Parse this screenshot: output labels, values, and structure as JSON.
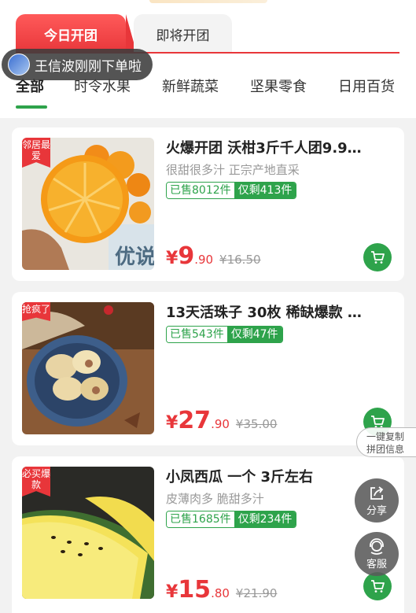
{
  "tabs": {
    "today": "今日开团",
    "upcoming": "即将开团"
  },
  "toast": {
    "text": "王信波刚刚下单啦"
  },
  "categories": [
    "全部",
    "时令水果",
    "新鲜蔬菜",
    "坚果零食",
    "日用百货"
  ],
  "products": [
    {
      "badge": "邻居最爱",
      "title": "火爆开团 沃柑3斤千人团9.9…",
      "subtitle": "很甜很多汁 正宗产地直采",
      "sold": "已售8012件",
      "remaining": "仅剩413件",
      "yen": "¥",
      "price_int": "9",
      "price_dec": ".90",
      "orig_price": "¥16.50"
    },
    {
      "badge": "抢疯了",
      "title": "13天活珠子 30枚 稀缺爆款 …",
      "subtitle": "",
      "sold": "已售543件",
      "remaining": "仅剩47件",
      "yen": "¥",
      "price_int": "27",
      "price_dec": ".90",
      "orig_price": "¥35.00"
    },
    {
      "badge": "必买爆款",
      "title": "小凤西瓜 一个 3斤左右",
      "subtitle": "皮薄肉多 脆甜多汁",
      "sold": "已售1685件",
      "remaining": "仅剩234件",
      "yen": "¥",
      "price_int": "15",
      "price_dec": ".80",
      "orig_price": "¥21.90"
    }
  ],
  "side": {
    "copy_line1": "一键复制",
    "copy_line2": "拼团信息",
    "share": "分享",
    "service": "客服"
  },
  "colors": {
    "accent_red": "#e8363a",
    "accent_green": "#2ea34b"
  }
}
